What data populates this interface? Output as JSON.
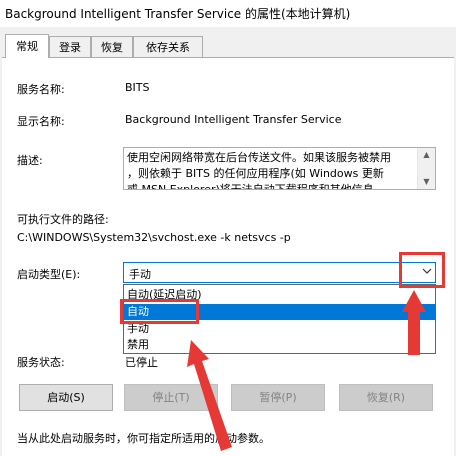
{
  "window": {
    "title": "Background Intelligent Transfer Service 的属性(本地计算机)"
  },
  "tabs": [
    {
      "label": "常规",
      "active": true
    },
    {
      "label": "登录",
      "active": false
    },
    {
      "label": "恢复",
      "active": false
    },
    {
      "label": "依存关系",
      "active": false
    }
  ],
  "fields": {
    "service_name_label": "服务名称:",
    "service_name_value": "BITS",
    "display_name_label": "显示名称:",
    "display_name_value": "Background Intelligent Transfer Service",
    "description_label": "描述:",
    "description_line1": "使用空闲网络带宽在后台传送文件。如果该服务被禁用",
    "description_line2": "，则依赖于 BITS 的任何应用程序(如 Windows 更新",
    "description_line3": "或 MSN Explorer)将无法自动下载程序和其他信息",
    "path_label": "可执行文件的路径:",
    "path_value": "C:\\WINDOWS\\System32\\svchost.exe -k netsvcs -p",
    "startup_type_label": "启动类型(E):",
    "service_status_label": "服务状态:",
    "service_status_value": "已停止"
  },
  "startup_select": {
    "value": "手动",
    "options": [
      "自动(延迟启动)",
      "自动",
      "手动",
      "禁用"
    ],
    "highlighted": "自动"
  },
  "buttons": {
    "start": "启动(S)",
    "stop": "停止(T)",
    "pause": "暂停(P)",
    "resume": "恢复(R)"
  },
  "footer_note": "当从此处启动服务时，你可指定所适用的启动参数。",
  "colors": {
    "highlight": "#0078d7",
    "annotation": "#e53935"
  }
}
